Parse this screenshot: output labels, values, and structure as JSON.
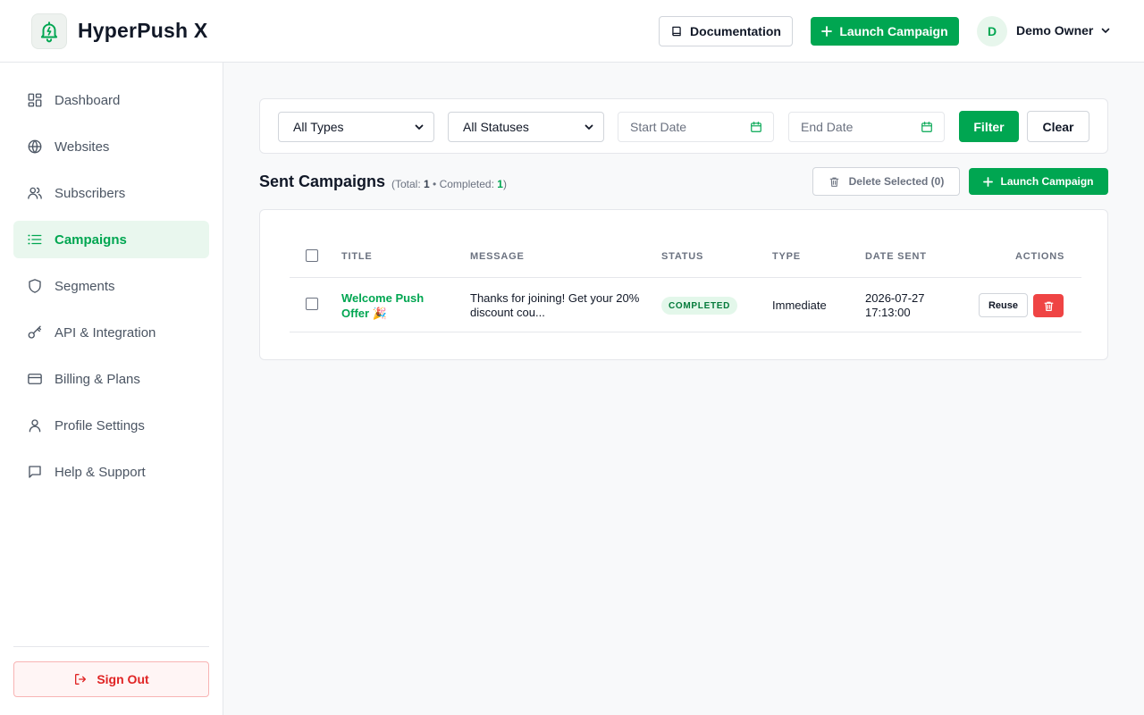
{
  "app": {
    "title": "HyperPush X"
  },
  "header": {
    "documentation_label": "Documentation",
    "launch_label": "Launch Campaign",
    "user_initial": "D",
    "user_name": "Demo Owner"
  },
  "sidebar": {
    "items": [
      {
        "label": "Dashboard",
        "icon": "dashboard-icon"
      },
      {
        "label": "Websites",
        "icon": "globe-icon"
      },
      {
        "label": "Subscribers",
        "icon": "users-icon"
      },
      {
        "label": "Campaigns",
        "icon": "list-icon",
        "active": true
      },
      {
        "label": "Segments",
        "icon": "shield-icon"
      },
      {
        "label": "API & Integration",
        "icon": "key-icon"
      },
      {
        "label": "Billing & Plans",
        "icon": "credit-card-icon"
      },
      {
        "label": "Profile Settings",
        "icon": "user-icon"
      },
      {
        "label": "Help & Support",
        "icon": "message-icon"
      }
    ],
    "sign_out_label": "Sign Out"
  },
  "filters": {
    "type_select": "All Types",
    "status_select": "All Statuses",
    "start_date_placeholder": "Start Date",
    "end_date_placeholder": "End Date",
    "filter_label": "Filter",
    "clear_label": "Clear"
  },
  "section": {
    "title": "Sent Campaigns",
    "meta_prefix": "(Total: ",
    "total": "1",
    "meta_sep": " • Completed: ",
    "completed": "1",
    "meta_suffix": ")",
    "delete_label": "Delete Selected (0)",
    "launch_label": "Launch Campaign"
  },
  "table": {
    "headers": [
      "TITLE",
      "MESSAGE",
      "STATUS",
      "TYPE",
      "DATE SENT",
      "ACTIONS"
    ],
    "rows": [
      {
        "title": "Welcome Push Offer 🎉",
        "message": "Thanks for joining! Get your 20% discount cou...",
        "status": "COMPLETED",
        "type": "Immediate",
        "date_line1": "2026-07-27",
        "date_line2": "17:13:00",
        "reuse_label": "Reuse"
      }
    ]
  },
  "colors": {
    "accent": "#00a651",
    "danger": "#ef4444",
    "active_bg": "#e9f7ee"
  }
}
